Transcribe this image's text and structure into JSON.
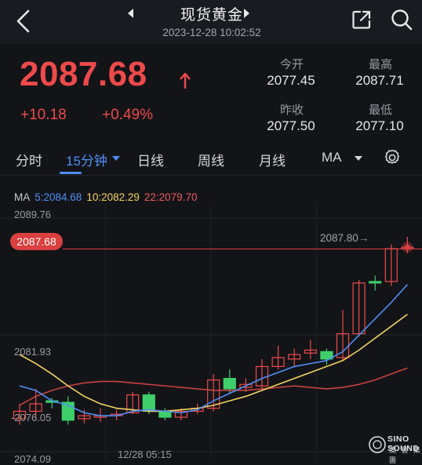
{
  "header": {
    "title": "现货黄金",
    "datetime": "2023-12-28 10:02:52"
  },
  "quote": {
    "price": "2087.68",
    "change": "+10.18",
    "change_pct": "+0.49%",
    "stats": [
      {
        "label": "今开",
        "value": "2077.45"
      },
      {
        "label": "最高",
        "value": "2087.71"
      },
      {
        "label": "昨收",
        "value": "2077.50"
      },
      {
        "label": "最低",
        "value": "2077.10"
      }
    ]
  },
  "tabs": [
    "分时",
    "15分钟",
    "日线",
    "周线",
    "月线",
    "MA"
  ],
  "active_tab": "15分钟",
  "ma": {
    "label": "MA",
    "ma5": "5:2084.68",
    "ma10": "10:2082.29",
    "ma22": "22:2079.70"
  },
  "chart_axes": {
    "top": "2089.76",
    "mid": "2081.93",
    "low": "-2076.05",
    "bottom": "2074.09",
    "current_price_tag": "2087.68",
    "last_label": "2087.80→",
    "time_label": "12/28 05:15"
  },
  "colors": {
    "up": "#ee4a4a",
    "down": "#3ecf6a",
    "ma5": "#4d8ff7",
    "ma10": "#f1d45e",
    "ma22": "#c8413f",
    "accent": "#4d8ff7"
  },
  "chart_data": {
    "type": "candlestick",
    "ylim": [
      2074.09,
      2089.76
    ],
    "candles": [
      {
        "o": 2076.3,
        "c": 2076.8,
        "h": 2077.3,
        "l": 2075.9
      },
      {
        "o": 2076.8,
        "c": 2077.3,
        "h": 2078.3,
        "l": 2076.3
      },
      {
        "o": 2077.5,
        "c": 2077.4,
        "h": 2077.7,
        "l": 2077.0
      },
      {
        "o": 2077.4,
        "c": 2076.2,
        "h": 2077.8,
        "l": 2075.9
      },
      {
        "o": 2076.3,
        "c": 2076.5,
        "h": 2076.9,
        "l": 2076.0
      },
      {
        "o": 2076.4,
        "c": 2076.5,
        "h": 2077.0,
        "l": 2076.1
      },
      {
        "o": 2076.5,
        "c": 2076.6,
        "h": 2076.9,
        "l": 2076.2
      },
      {
        "o": 2076.7,
        "c": 2077.9,
        "h": 2078.1,
        "l": 2076.6
      },
      {
        "o": 2077.9,
        "c": 2076.8,
        "h": 2078.1,
        "l": 2076.6
      },
      {
        "o": 2076.8,
        "c": 2076.4,
        "h": 2077.0,
        "l": 2076.2
      },
      {
        "o": 2076.4,
        "c": 2076.8,
        "h": 2077.0,
        "l": 2076.2
      },
      {
        "o": 2076.8,
        "c": 2077.0,
        "h": 2077.3,
        "l": 2076.6
      },
      {
        "o": 2077.0,
        "c": 2078.9,
        "h": 2079.3,
        "l": 2076.8
      },
      {
        "o": 2079.0,
        "c": 2078.3,
        "h": 2079.6,
        "l": 2078.0
      },
      {
        "o": 2078.4,
        "c": 2078.6,
        "h": 2079.0,
        "l": 2078.1
      },
      {
        "o": 2078.5,
        "c": 2079.8,
        "h": 2080.3,
        "l": 2078.3
      },
      {
        "o": 2079.8,
        "c": 2080.4,
        "h": 2081.2,
        "l": 2079.6
      },
      {
        "o": 2080.3,
        "c": 2080.6,
        "h": 2081.0,
        "l": 2079.8
      },
      {
        "o": 2080.7,
        "c": 2080.9,
        "h": 2081.6,
        "l": 2080.3
      },
      {
        "o": 2080.8,
        "c": 2080.3,
        "h": 2081.0,
        "l": 2079.9
      },
      {
        "o": 2080.4,
        "c": 2082.0,
        "h": 2083.6,
        "l": 2080.2
      },
      {
        "o": 2082.0,
        "c": 2085.4,
        "h": 2085.6,
        "l": 2081.8
      },
      {
        "o": 2085.5,
        "c": 2085.4,
        "h": 2085.9,
        "l": 2084.9
      },
      {
        "o": 2085.5,
        "c": 2087.7,
        "h": 2088.0,
        "l": 2085.2
      },
      {
        "o": 2087.7,
        "c": 2087.8,
        "h": 2088.5,
        "l": 2087.4
      }
    ],
    "ma5": [
      2078.5,
      2078.2,
      2077.5,
      2077.2,
      2076.7,
      2076.5,
      2076.5,
      2076.8,
      2076.9,
      2076.8,
      2076.7,
      2076.9,
      2077.5,
      2078.0,
      2078.5,
      2079.0,
      2079.4,
      2079.8,
      2080.0,
      2080.2,
      2080.8,
      2081.9,
      2083.0,
      2084.1,
      2085.3
    ],
    "ma10": [
      2080.6,
      2080.0,
      2079.3,
      2078.5,
      2077.8,
      2077.3,
      2077.0,
      2076.9,
      2076.8,
      2076.8,
      2076.9,
      2077.0,
      2077.2,
      2077.5,
      2077.8,
      2078.2,
      2078.6,
      2079.0,
      2079.4,
      2079.8,
      2080.2,
      2080.9,
      2081.7,
      2082.5,
      2083.3
    ],
    "ma22": [
      2077.2,
      2077.8,
      2078.2,
      2078.5,
      2078.7,
      2078.8,
      2078.8,
      2078.7,
      2078.6,
      2078.5,
      2078.4,
      2078.3,
      2078.2,
      2078.2,
      2078.2,
      2078.3,
      2078.4,
      2078.5,
      2078.4,
      2078.3,
      2078.4,
      2078.6,
      2078.9,
      2079.3,
      2079.7
    ],
    "current_price": 2087.68
  }
}
